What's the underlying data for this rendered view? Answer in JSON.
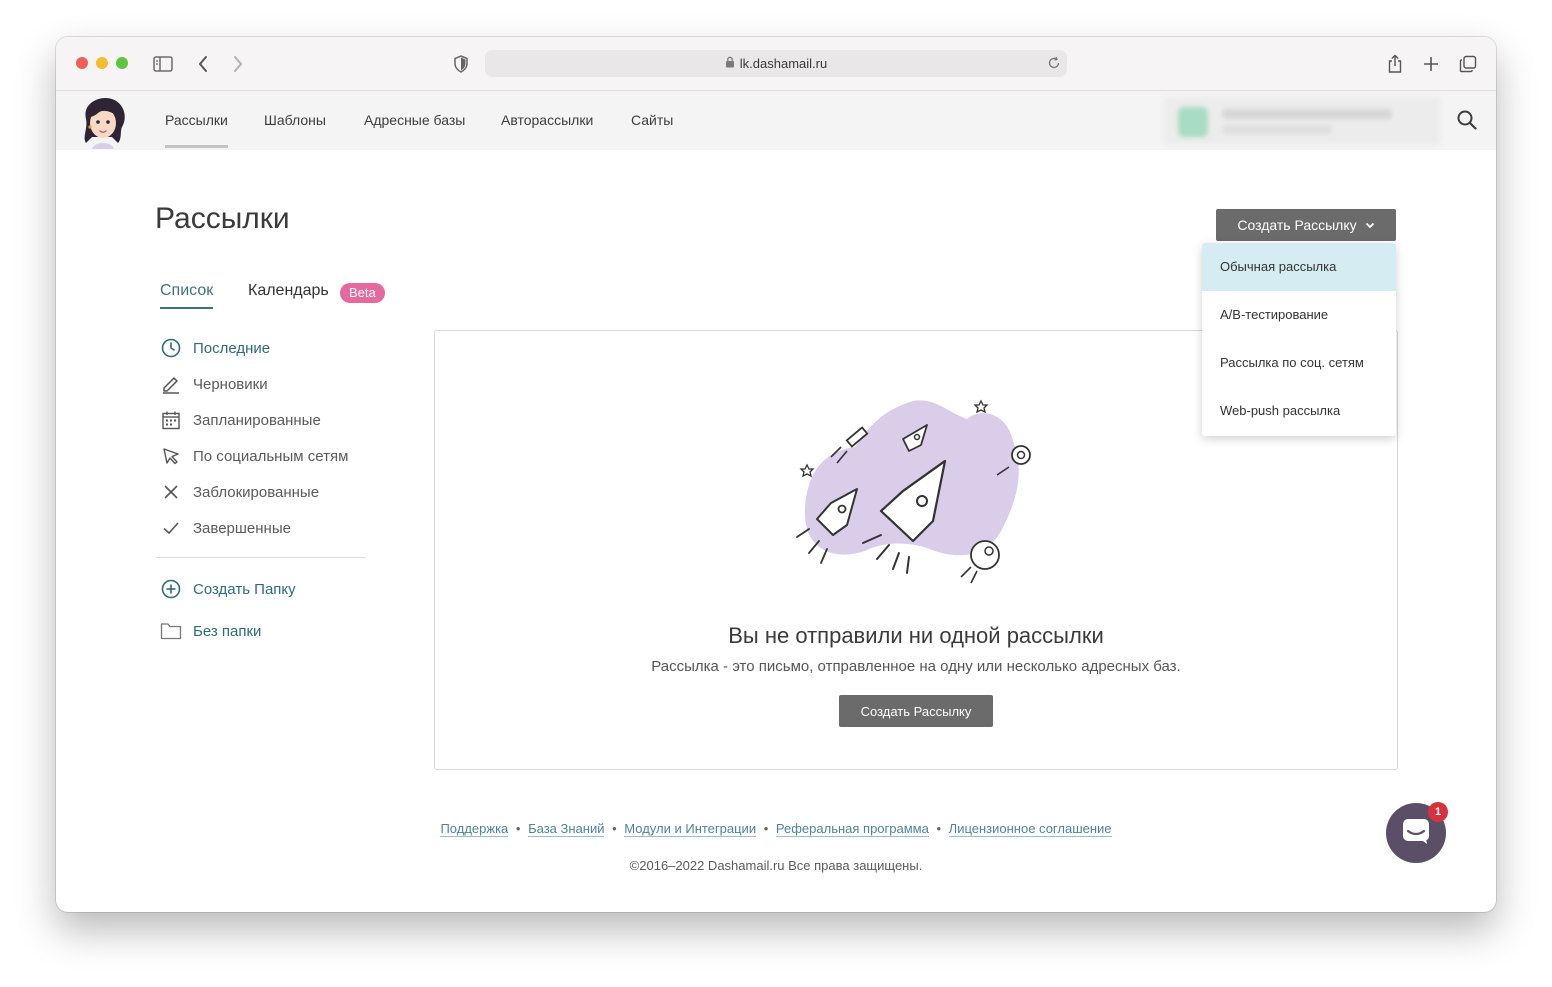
{
  "browser": {
    "url": "lk.dashamail.ru"
  },
  "nav": {
    "items": [
      "Рассылки",
      "Шаблоны",
      "Адресные базы",
      "Авторассылки",
      "Сайты"
    ]
  },
  "page": {
    "title": "Рассылки",
    "create_button": "Создать Рассылку",
    "tabs": [
      "Список",
      "Календарь"
    ],
    "beta_badge": "Beta"
  },
  "dropdown": {
    "items": [
      "Обычная рассылка",
      "A/B-тестирование",
      "Рассылка по соц. сетям",
      "Web-push рассылка"
    ]
  },
  "sidebar": {
    "items": [
      "Последние",
      "Черновики",
      "Запланированные",
      "По социальным сетям",
      "Заблокированные",
      "Завершенные"
    ],
    "create_folder": "Создать Папку",
    "no_folder": "Без папки"
  },
  "empty_state": {
    "title": "Вы не отправили ни одной рассылки",
    "subtitle": "Рассылка - это письмо, отправленное на одну или несколько адресных баз.",
    "button": "Создать Рассылку"
  },
  "footer": {
    "links": [
      "Поддержка",
      "База Знаний",
      "Модули и Интеграции",
      "Реферальная программа",
      "Лицензионное соглашение"
    ],
    "separator": "•",
    "copyright": "©2016–2022 Dashamail.ru Все права защищены."
  },
  "chat": {
    "badge": "1"
  },
  "colors": {
    "accent_teal": "#3d7283",
    "button_gray": "#6b6b6b",
    "beta_pink": "#e4699d",
    "dropdown_highlight": "#d5ecf2",
    "illustration_lilac": "#d9cdea"
  }
}
